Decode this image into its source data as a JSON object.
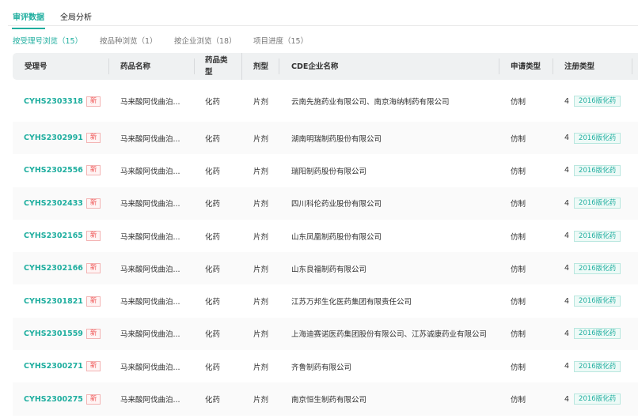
{
  "tabs": [
    {
      "label": "审评数据"
    },
    {
      "label": "全局分析"
    }
  ],
  "subtabs": [
    {
      "label": "按受理号浏览（15）"
    },
    {
      "label": "按品种浏览（1）"
    },
    {
      "label": "按企业浏览（18）"
    },
    {
      "label": "项目进度（15）"
    }
  ],
  "columns": [
    "受理号",
    "药品名称",
    "药品类型",
    "剂型",
    "CDE企业名称",
    "申请类型",
    "注册类型"
  ],
  "rows": [
    {
      "id": "CYHS2303318",
      "badge": "新",
      "drug": "马来酸阿伐曲泊...",
      "type": "化药",
      "form": "片剂",
      "company": "云南先施药业有限公司、南京海纳制药有限公司",
      "apply": "仿制",
      "reg_num": "4",
      "reg_tag": "2016版化药"
    },
    {
      "id": "CYHS2302991",
      "badge": "新",
      "drug": "马来酸阿伐曲泊...",
      "type": "化药",
      "form": "片剂",
      "company": "湖南明瑞制药股份有限公司",
      "apply": "仿制",
      "reg_num": "4",
      "reg_tag": "2016版化药"
    },
    {
      "id": "CYHS2302556",
      "badge": "新",
      "drug": "马来酸阿伐曲泊...",
      "type": "化药",
      "form": "片剂",
      "company": "瑞阳制药股份有限公司",
      "apply": "仿制",
      "reg_num": "4",
      "reg_tag": "2016版化药"
    },
    {
      "id": "CYHS2302433",
      "badge": "新",
      "drug": "马来酸阿伐曲泊...",
      "type": "化药",
      "form": "片剂",
      "company": "四川科伦药业股份有限公司",
      "apply": "仿制",
      "reg_num": "4",
      "reg_tag": "2016版化药"
    },
    {
      "id": "CYHS2302165",
      "badge": "新",
      "drug": "马来酸阿伐曲泊...",
      "type": "化药",
      "form": "片剂",
      "company": "山东凤凰制药股份有限公司",
      "apply": "仿制",
      "reg_num": "4",
      "reg_tag": "2016版化药"
    },
    {
      "id": "CYHS2302166",
      "badge": "新",
      "drug": "马来酸阿伐曲泊...",
      "type": "化药",
      "form": "片剂",
      "company": "山东良福制药有限公司",
      "apply": "仿制",
      "reg_num": "4",
      "reg_tag": "2016版化药"
    },
    {
      "id": "CYHS2301821",
      "badge": "新",
      "drug": "马来酸阿伐曲泊...",
      "type": "化药",
      "form": "片剂",
      "company": "江苏万邦生化医药集团有限责任公司",
      "apply": "仿制",
      "reg_num": "4",
      "reg_tag": "2016版化药"
    },
    {
      "id": "CYHS2301559",
      "badge": "新",
      "drug": "马来酸阿伐曲泊...",
      "type": "化药",
      "form": "片剂",
      "company": "上海迪赛诺医药集团股份有限公司、江苏诚康药业有限公司",
      "apply": "仿制",
      "reg_num": "4",
      "reg_tag": "2016版化药"
    },
    {
      "id": "CYHS2300271",
      "badge": "新",
      "drug": "马来酸阿伐曲泊...",
      "type": "化药",
      "form": "片剂",
      "company": "齐鲁制药有限公司",
      "apply": "仿制",
      "reg_num": "4",
      "reg_tag": "2016版化药"
    },
    {
      "id": "CYHS2300275",
      "badge": "新",
      "drug": "马来酸阿伐曲泊...",
      "type": "化药",
      "form": "片剂",
      "company": "南京恒生制药有限公司",
      "apply": "仿制",
      "reg_num": "4",
      "reg_tag": "2016版化药"
    }
  ]
}
